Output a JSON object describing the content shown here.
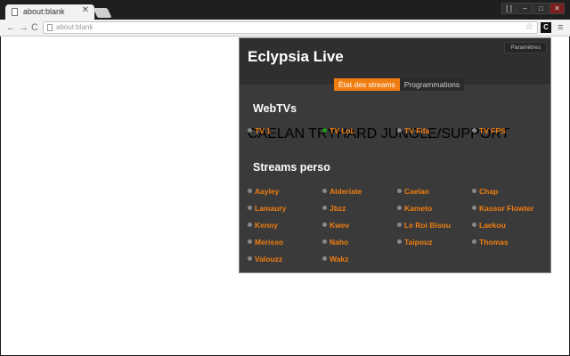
{
  "browser": {
    "tab_title": "about:blank",
    "tab_close": "✕",
    "url": "about:blank",
    "back": "←",
    "forward": "→",
    "reload": "C",
    "star": "☆",
    "extension_label": "C",
    "menu": "≡",
    "window_buttons": [
      "[ ]",
      "–",
      "□",
      "✕"
    ]
  },
  "popup": {
    "title": "Eclypsia Live",
    "settings_label": "Paramètres",
    "tabs": [
      {
        "label": "État des streams",
        "active": true
      },
      {
        "label": "Programmations",
        "active": false
      }
    ],
    "webtvs": {
      "title": "WebTVs",
      "items": [
        {
          "name": "TV 1",
          "live": false
        },
        {
          "name": "TV LoL",
          "live": true,
          "line1": "CAELAN TRYHARD",
          "line2": "JUNGLE/SUPPORT"
        },
        {
          "name": "TV Fifa",
          "live": false
        },
        {
          "name": "TV FPS",
          "live": false
        }
      ]
    },
    "streams": {
      "title": "Streams perso",
      "items": [
        "Aayley",
        "Alderiate",
        "Caelan",
        "Chap",
        "Lamaury",
        "Jbzz",
        "Kameto",
        "Kassor Flowter",
        "Kenny",
        "Kwev",
        "Le Roi Bisou",
        "Laekou",
        "Merisso",
        "Naho",
        "Taipouz",
        "Thomas",
        "Valouzz",
        "Wakz"
      ]
    },
    "colors": {
      "accent": "#f07d10",
      "live": "#1a9a1a",
      "offline": "#888888"
    }
  }
}
